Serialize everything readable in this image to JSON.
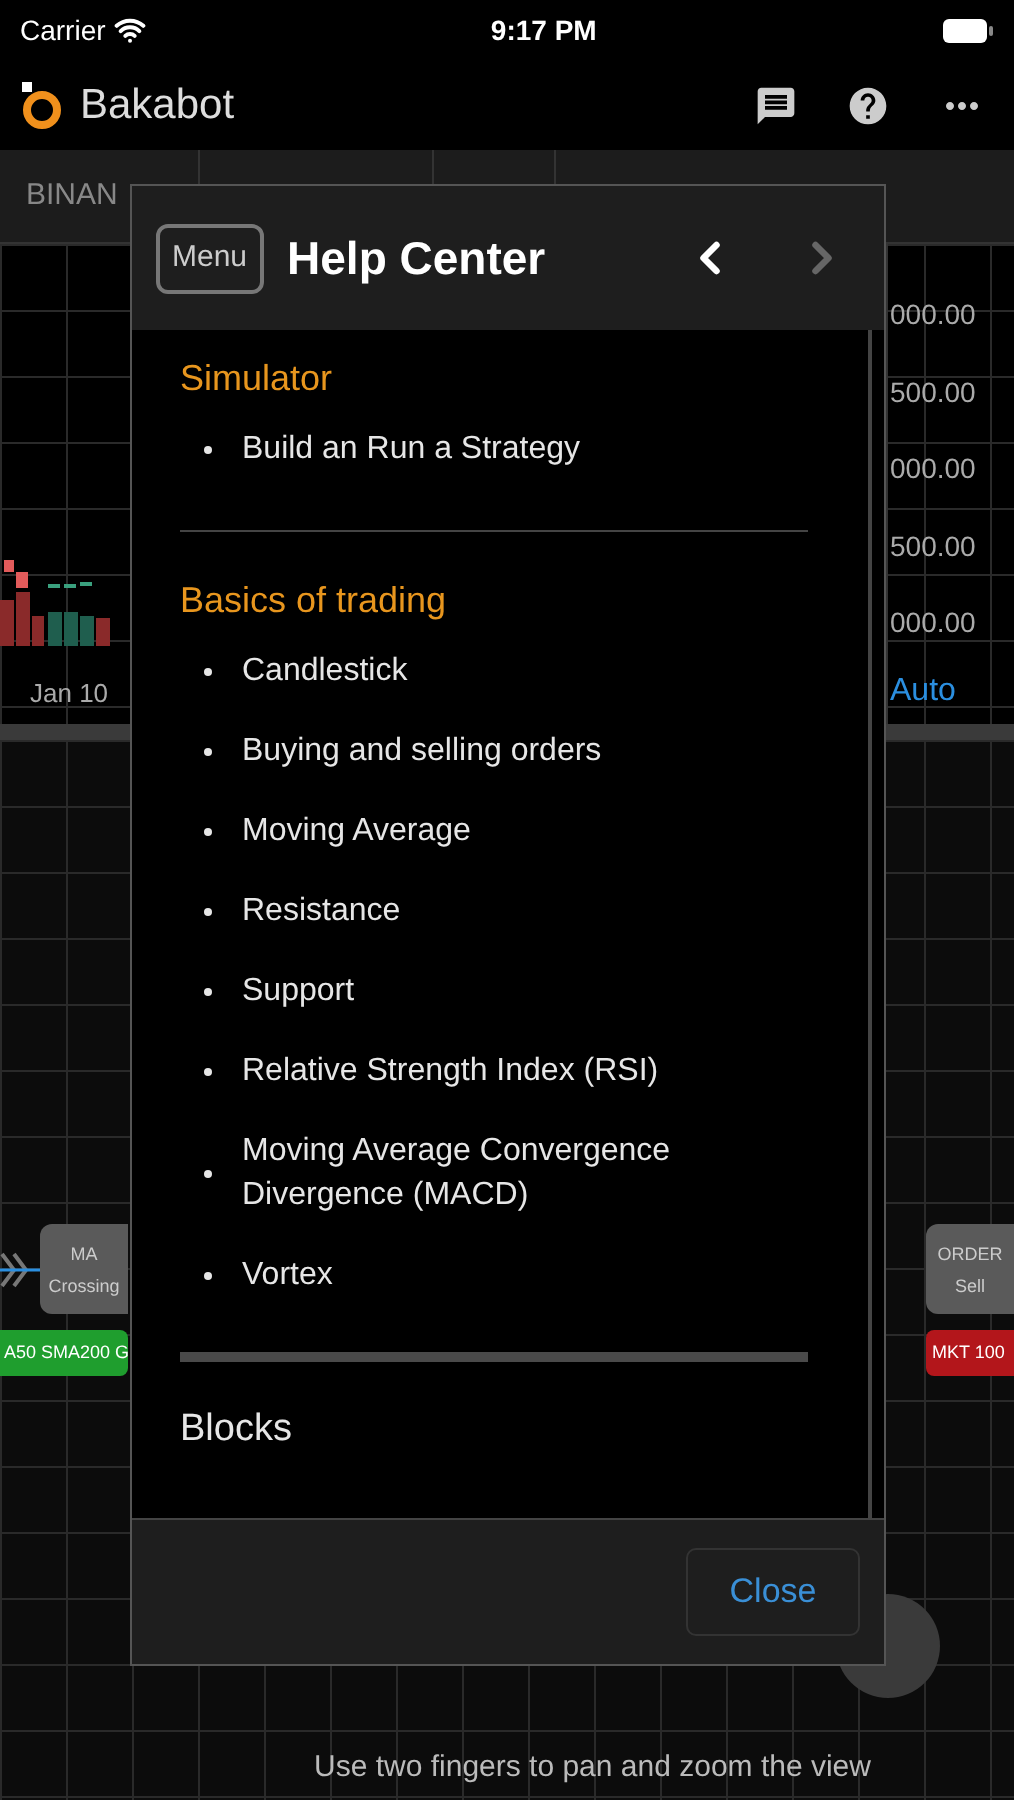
{
  "status_bar": {
    "carrier": "Carrier",
    "time": "9:17 PM"
  },
  "app_bar": {
    "title": "Bakabot"
  },
  "toolbar": {
    "exchange": "BINAN"
  },
  "chart": {
    "date_label": "Jan 10",
    "price_labels": [
      "000.00",
      "500.00",
      "000.00",
      "500.00",
      "000.00"
    ],
    "scale_mode": "Auto"
  },
  "canvas": {
    "left_node": {
      "lines": [
        "MA",
        "Crossing"
      ],
      "tag": "A50 SMA200 G",
      "color": "#1f9e2e"
    },
    "right_node": {
      "lines": [
        "ORDER",
        "Sell"
      ],
      "tag": "MKT 100",
      "color": "#b3161b"
    },
    "hint": "Use two fingers to pan and zoom the view"
  },
  "help_center": {
    "menu_button": "Menu",
    "title": "Help Center",
    "back_disabled": false,
    "forward_disabled": true,
    "content": [
      {
        "kind": "section",
        "title": "Simulator",
        "items": [
          "Build an Run a Strategy"
        ]
      },
      {
        "kind": "rule"
      },
      {
        "kind": "section",
        "title": "Basics of trading",
        "items": [
          "Candlestick",
          "Buying and selling orders",
          "Moving Average",
          "Resistance",
          "Support",
          "Relative Strength Index (RSI)",
          "Moving Average Convergence Divergence (MACD)",
          "Vortex"
        ]
      },
      {
        "kind": "thick-rule"
      },
      {
        "kind": "link",
        "title": "Blocks"
      }
    ],
    "close_button": "Close"
  }
}
